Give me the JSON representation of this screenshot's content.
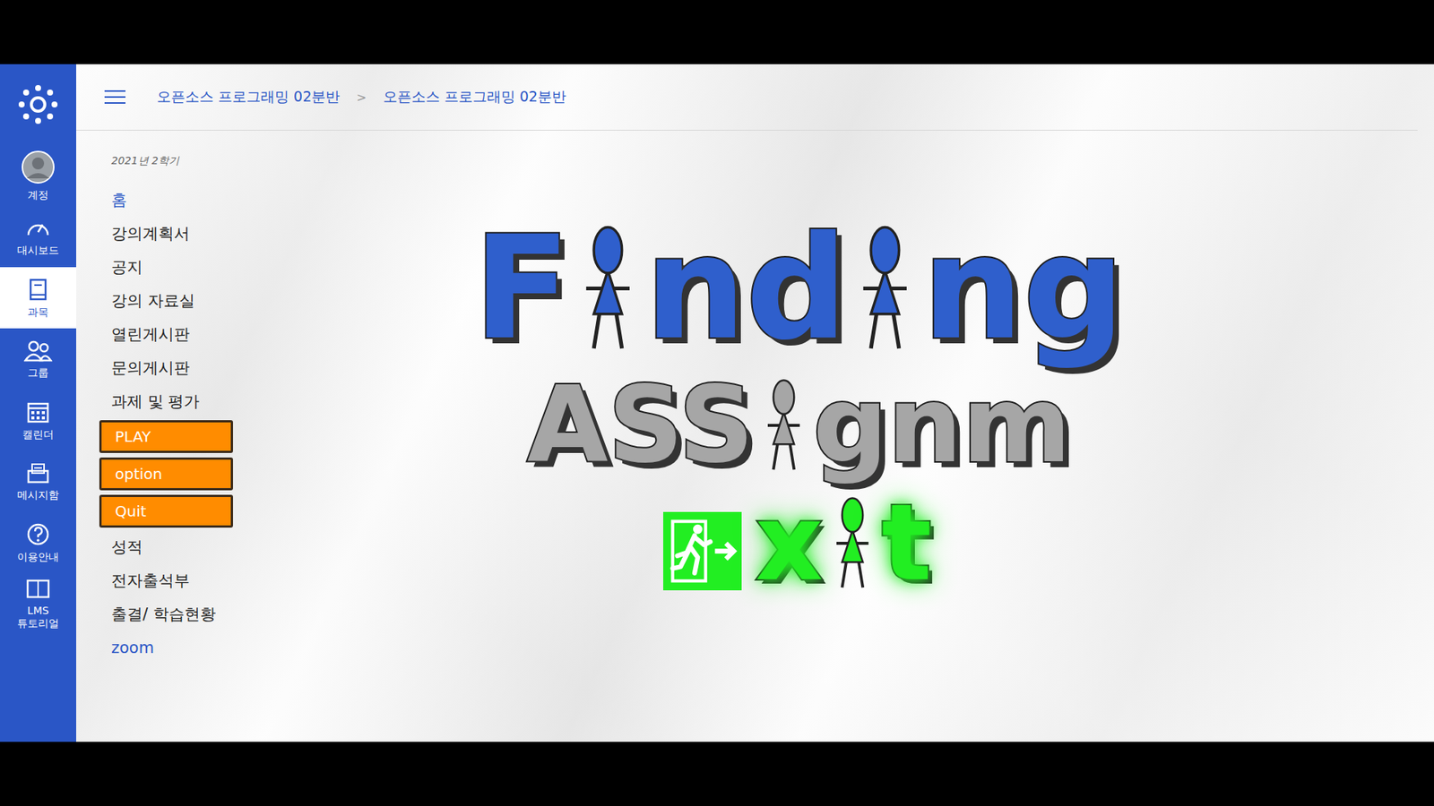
{
  "sidebar": {
    "items": [
      {
        "label": "계정",
        "kind": "account",
        "selected": false
      },
      {
        "label": "대시보드",
        "kind": "dashboard",
        "selected": false
      },
      {
        "label": "과목",
        "kind": "courses",
        "selected": true
      },
      {
        "label": "그룹",
        "kind": "groups",
        "selected": false
      },
      {
        "label": "캘린더",
        "kind": "calendar",
        "selected": false
      },
      {
        "label": "메시지함",
        "kind": "inbox",
        "selected": false
      },
      {
        "label": "이용안내",
        "kind": "help",
        "selected": false
      },
      {
        "label": "LMS\n튜토리얼",
        "kind": "tutorial",
        "selected": false
      }
    ]
  },
  "breadcrumb": {
    "items": [
      "오픈소스 프로그래밍 02분반",
      "오픈소스 프로그래밍 02분반"
    ],
    "separator": ">"
  },
  "course_nav": {
    "term": "2021년 2학기",
    "items": [
      {
        "label": "홈",
        "kind": "link",
        "color": "#2a56c6"
      },
      {
        "label": "강의계획서",
        "kind": "link",
        "color": "#222222"
      },
      {
        "label": "공지",
        "kind": "link",
        "color": "#222222"
      },
      {
        "label": "강의 자료실",
        "kind": "link",
        "color": "#222222"
      },
      {
        "label": "열린게시판",
        "kind": "link",
        "color": "#222222"
      },
      {
        "label": "문의게시판",
        "kind": "link",
        "color": "#222222"
      },
      {
        "label": "과제 및 평가",
        "kind": "link",
        "color": "#222222"
      },
      {
        "label": "PLAY",
        "kind": "button",
        "color": "#ff8c00"
      },
      {
        "label": "option",
        "kind": "button",
        "color": "#ff8c00"
      },
      {
        "label": "Quit",
        "kind": "button",
        "color": "#ff8c00"
      },
      {
        "label": "성적",
        "kind": "link",
        "color": "#222222"
      },
      {
        "label": "전자출석부",
        "kind": "link",
        "color": "#222222"
      },
      {
        "label": "출결/ 학습현황",
        "kind": "link",
        "color": "#222222"
      },
      {
        "label": "zoom",
        "kind": "link",
        "color": "#2a56c6"
      }
    ]
  },
  "title": {
    "lines": [
      {
        "color": "#2f5fcc",
        "glow": false,
        "parts": [
          {
            "kind": "text",
            "text": "F"
          },
          {
            "kind": "figure"
          },
          {
            "kind": "text",
            "text": "nd"
          },
          {
            "kind": "figure"
          },
          {
            "kind": "text",
            "text": "ng"
          }
        ]
      },
      {
        "color": "#a6a6a6",
        "glow": false,
        "parts": [
          {
            "kind": "text",
            "text": "ASS"
          },
          {
            "kind": "figure"
          },
          {
            "kind": "text",
            "text": "gnm"
          }
        ]
      },
      {
        "color": "#22ee22",
        "glow": true,
        "parts": [
          {
            "kind": "exit-sign"
          },
          {
            "kind": "text",
            "text": "x"
          },
          {
            "kind": "figure"
          },
          {
            "kind": "text",
            "text": "t"
          }
        ]
      }
    ]
  }
}
